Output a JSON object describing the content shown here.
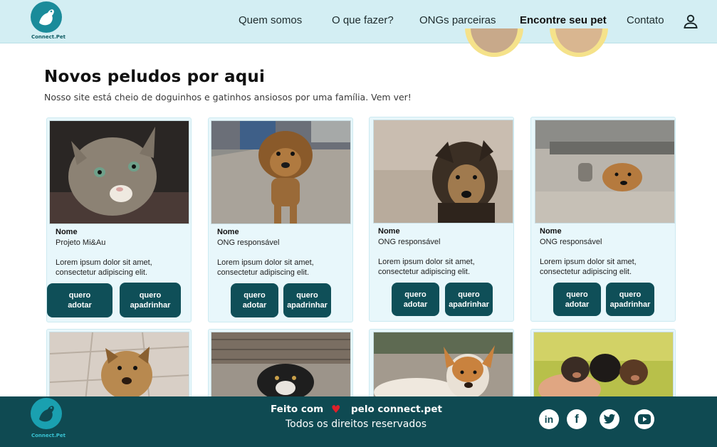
{
  "brand": {
    "name": "Connect.Pet",
    "accent": "#0f4f58",
    "header_bg": "#d3eef3"
  },
  "nav": {
    "items": [
      {
        "label": "Quem somos"
      },
      {
        "label": "O que fazer?"
      },
      {
        "label": "ONGs parceiras"
      },
      {
        "label": "Encontre seu pet",
        "active": true
      },
      {
        "label": "Contato"
      }
    ],
    "user_icon": "user-icon"
  },
  "intro": {
    "title": "Novos peludos por aqui",
    "subtitle": "Nosso site está cheio de doguinhos e gatinhos ansiosos por uma família. Vem ver!"
  },
  "cards": [
    {
      "photo": "cat",
      "name_label": "Nome",
      "org": "Projeto Mi&Au",
      "desc": "Lorem ipsum dolor sit amet, consectetur adipiscing elit.",
      "adopt": "quero\nadotar",
      "sponsor": "quero\napadrinhar"
    },
    {
      "photo": "puppy-street",
      "name_label": "Nome",
      "org": "ONG responsável",
      "desc": "Lorem ipsum dolor sit amet, consectetur adipiscing elit.",
      "adopt": "quero\nadotar",
      "sponsor": "quero\napadrinhar"
    },
    {
      "photo": "dog-shepherd",
      "name_label": "Nome",
      "org": "ONG responsável",
      "desc": "Lorem ipsum dolor sit amet, consectetur adipiscing elit.",
      "adopt": "quero\nadotar",
      "sponsor": "quero\napadrinhar"
    },
    {
      "photo": "dog-under-car",
      "name_label": "Nome",
      "org": "ONG responsável",
      "desc": "Lorem ipsum dolor sit amet, consectetur adipiscing elit.",
      "adopt": "quero\nadotar",
      "sponsor": "quero\napadrinhar"
    }
  ],
  "lower_cards": [
    {
      "photo": "dog-tiles"
    },
    {
      "photo": "dog-under-fence"
    },
    {
      "photo": "dog-lying"
    },
    {
      "photo": "puppies-hand"
    }
  ],
  "footer": {
    "made_with": "Feito com",
    "made_by": "pelo connect.pet",
    "rights": "Todos os direitos reservados",
    "social": [
      {
        "icon": "linkedin-icon",
        "glyph": "in"
      },
      {
        "icon": "facebook-icon",
        "glyph": "f"
      },
      {
        "icon": "twitter-icon",
        "glyph": "t"
      },
      {
        "icon": "youtube-icon",
        "glyph": "▶"
      }
    ]
  }
}
